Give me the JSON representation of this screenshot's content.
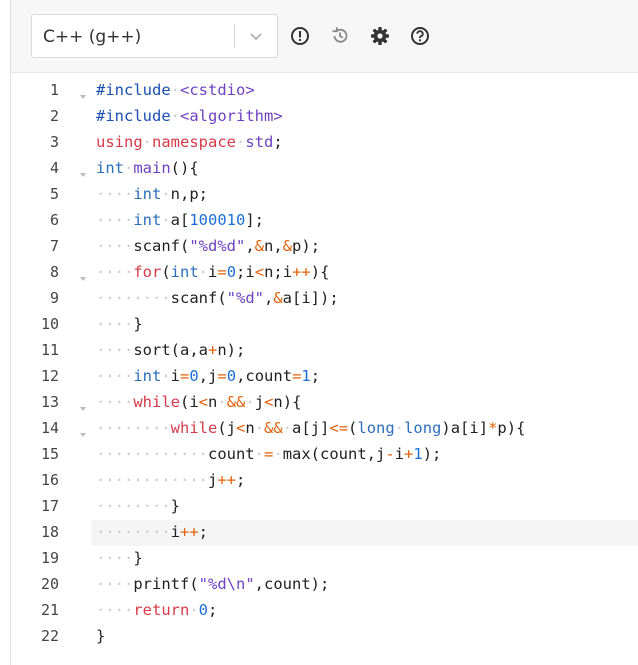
{
  "toolbar": {
    "language": "C++ (g++)",
    "buttons": [
      {
        "name": "info-button",
        "icon": "exclamation-circle-icon"
      },
      {
        "name": "history-button",
        "icon": "history-icon"
      },
      {
        "name": "settings-button",
        "icon": "gear-icon"
      },
      {
        "name": "help-button",
        "icon": "question-circle-icon"
      }
    ]
  },
  "editor": {
    "active_line": 18,
    "lines": [
      {
        "n": "1",
        "fold": true,
        "html": "<span class='pp'>#include</span><span class='ws'>·</span><span class='st'>&lt;cstdio&gt;</span>"
      },
      {
        "n": "2",
        "fold": false,
        "html": "<span class='pp'>#include</span><span class='ws'>·</span><span class='st'>&lt;algorithm&gt;</span>"
      },
      {
        "n": "3",
        "fold": false,
        "html": "<span class='kw'>using</span><span class='ws'>·</span><span class='kw'>namespace</span><span class='ws'>·</span><span class='fn'>std</span>;"
      },
      {
        "n": "4",
        "fold": true,
        "html": "<span class='ty'>int</span><span class='ws'>·</span><span class='fn'>main</span>(){"
      },
      {
        "n": "5",
        "fold": false,
        "html": "<span class='ws'>····</span><span class='ty'>int</span><span class='ws'>·</span>n,p;"
      },
      {
        "n": "6",
        "fold": false,
        "html": "<span class='ws'>····</span><span class='ty'>int</span><span class='ws'>·</span>a[<span class='nm'>100010</span>];"
      },
      {
        "n": "7",
        "fold": false,
        "html": "<span class='ws'>····</span>scanf(<span class='st'>\"%d%d\"</span>,<span class='op'>&amp;</span>n,<span class='op'>&amp;</span>p);"
      },
      {
        "n": "8",
        "fold": true,
        "html": "<span class='ws'>····</span><span class='kw'>for</span>(<span class='ty'>int</span><span class='ws'>·</span>i<span class='op'>=</span><span class='nm'>0</span>;i<span class='op'>&lt;</span>n;i<span class='op'>++</span>){"
      },
      {
        "n": "9",
        "fold": false,
        "html": "<span class='ws'>········</span>scanf(<span class='st'>\"%d\"</span>,<span class='op'>&amp;</span>a[i]);"
      },
      {
        "n": "10",
        "fold": false,
        "html": "<span class='ws'>····</span>}"
      },
      {
        "n": "11",
        "fold": false,
        "html": "<span class='ws'>····</span>sort(a,a<span class='op'>+</span>n);"
      },
      {
        "n": "12",
        "fold": false,
        "html": "<span class='ws'>····</span><span class='ty'>int</span><span class='ws'>·</span>i<span class='op'>=</span><span class='nm'>0</span>,j<span class='op'>=</span><span class='nm'>0</span>,count<span class='op'>=</span><span class='nm'>1</span>;"
      },
      {
        "n": "13",
        "fold": true,
        "html": "<span class='ws'>····</span><span class='kw'>while</span>(i<span class='op'>&lt;</span>n<span class='ws'>·</span><span class='op'>&amp;&amp;</span><span class='ws'>·</span>j<span class='op'>&lt;</span>n){"
      },
      {
        "n": "14",
        "fold": true,
        "html": "<span class='ws'>········</span><span class='kw'>while</span>(j<span class='op'>&lt;</span>n<span class='ws'>·</span><span class='op'>&amp;&amp;</span><span class='ws'>·</span>a[j]<span class='op'>&lt;=</span>(<span class='ty'>long</span><span class='ws'>·</span><span class='ty'>long</span>)a[i]<span class='op'>*</span>p){"
      },
      {
        "n": "15",
        "fold": false,
        "html": "<span class='ws'>············</span>count<span class='ws'>·</span><span class='op'>=</span><span class='ws'>·</span>max(count,j<span class='op'>-</span>i<span class='op'>+</span><span class='nm'>1</span>);"
      },
      {
        "n": "16",
        "fold": false,
        "html": "<span class='ws'>············</span>j<span class='op'>++</span>;"
      },
      {
        "n": "17",
        "fold": false,
        "html": "<span class='ws'>········</span>}"
      },
      {
        "n": "18",
        "fold": false,
        "html": "<span class='ws'>········</span>i<span class='op'>++</span>;"
      },
      {
        "n": "19",
        "fold": false,
        "html": "<span class='ws'>····</span>}"
      },
      {
        "n": "20",
        "fold": false,
        "html": "<span class='ws'>····</span>printf(<span class='st'>\"%d\\n\"</span>,count);"
      },
      {
        "n": "21",
        "fold": false,
        "html": "<span class='ws'>····</span><span class='kw'>return</span><span class='ws'>·</span><span class='nm'>0</span>;"
      },
      {
        "n": "22",
        "fold": false,
        "html": "}"
      }
    ]
  }
}
